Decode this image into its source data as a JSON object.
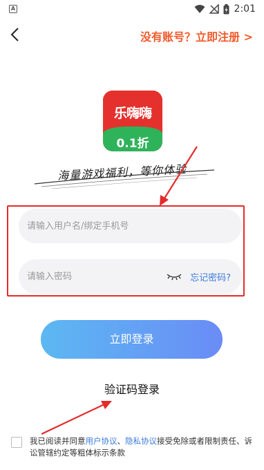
{
  "status_bar": {
    "notification_icon_label": "A",
    "time": "2:01",
    "icons": [
      "wifi-icon",
      "signal-icon",
      "battery-icon"
    ]
  },
  "header": {
    "back_icon": "chevron-left-icon",
    "register_text": "没有账号？立即注册 >"
  },
  "logo": {
    "name": "乐嗨嗨",
    "sub": "0.1折"
  },
  "slogan": "海量游戏福利，等你体验",
  "form": {
    "username_placeholder": "请输入用户名/绑定手机号",
    "password_placeholder": "请输入密码",
    "forgot_password": "忘记密码?",
    "eye_icon": "eye-closed-icon"
  },
  "login_button": "立即登录",
  "sms_login": "验证码登录",
  "agreement": {
    "prefix": "我已阅读并同意",
    "user_agreement": "用户协议",
    "separator": "、",
    "privacy_agreement": "隐私协议",
    "suffix": "接受免除或者限制责任、诉讼管辖约定等粗体标示条款"
  },
  "colors": {
    "accent_orange": "#f25a2a",
    "link_blue": "#3a7bdc",
    "annotation_red": "#e52a2a",
    "button_gradient_start": "#5cb8f2",
    "button_gradient_end": "#6a8cf6",
    "logo_red": "#e5312d",
    "logo_green": "#2fb35a"
  }
}
